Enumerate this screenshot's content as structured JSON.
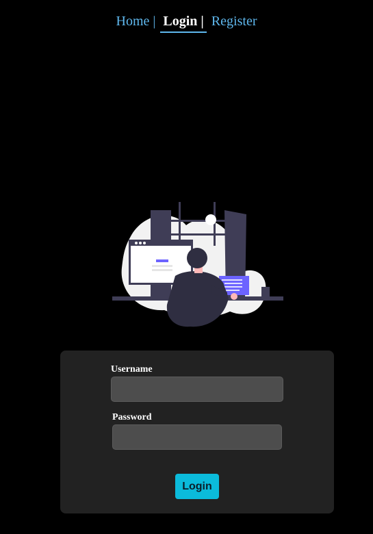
{
  "nav": {
    "home": "Home |",
    "login": "Login |",
    "register": "Register"
  },
  "illustration": {
    "name": "person-at-computer-illustration",
    "colors": {
      "backdrop": "#f2f2f2",
      "dark": "#3f3d56",
      "accent": "#6c63ff"
    }
  },
  "form": {
    "username_label": "Username",
    "username_value": "",
    "password_label": "Password",
    "password_value": "",
    "submit_label": "Login"
  },
  "colors": {
    "background": "#000000",
    "card": "#222222",
    "link": "#5fb8ee",
    "button": "#0bbbdb"
  }
}
